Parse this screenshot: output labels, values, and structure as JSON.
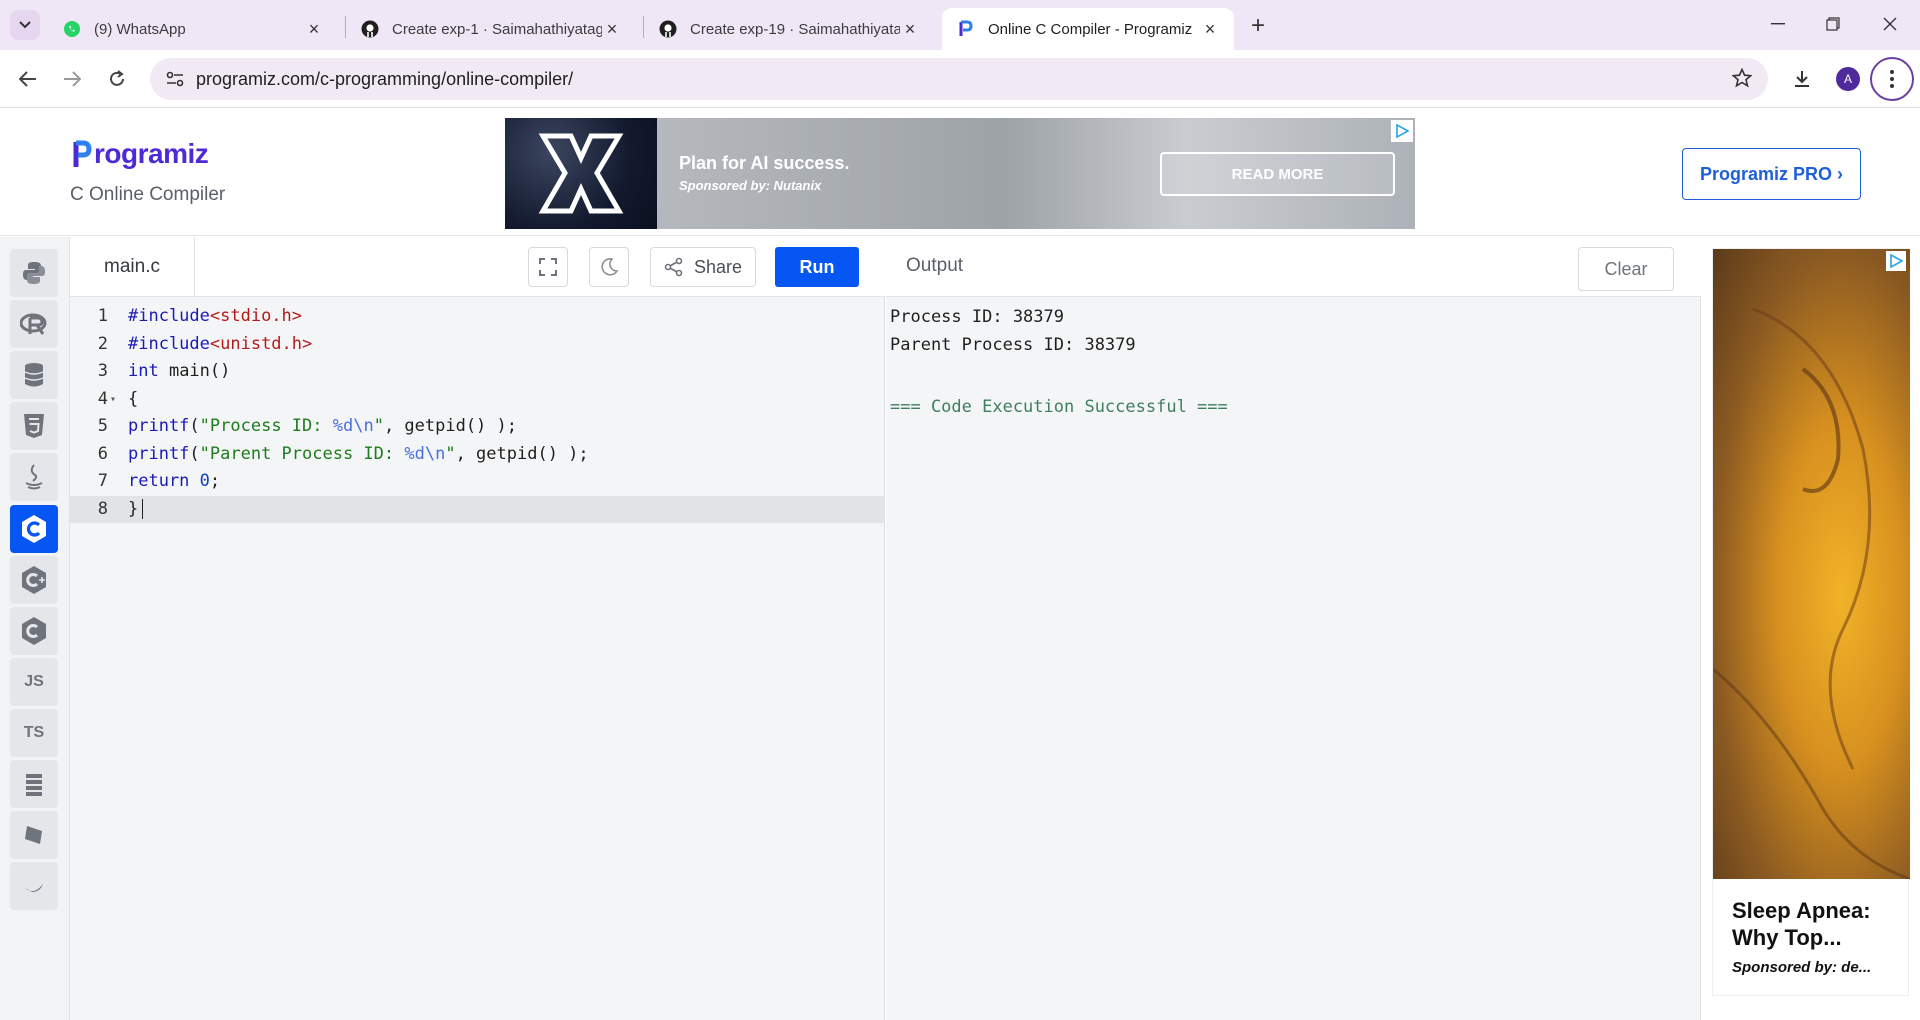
{
  "browser": {
    "tabs": [
      {
        "title": "(9) WhatsApp",
        "icon": "whatsapp-icon",
        "active": false
      },
      {
        "title": "Create exp-1 · Saimahathiyatagi",
        "icon": "github-icon",
        "active": false
      },
      {
        "title": "Create exp-19 · Saimahathiyata",
        "icon": "github-icon",
        "active": false
      },
      {
        "title": "Online C Compiler - Programiz",
        "icon": "programiz-icon",
        "active": true
      }
    ],
    "url": "programiz.com/c-programming/online-compiler/",
    "profile_initial": "A"
  },
  "header": {
    "logo_text": "rogramiz",
    "subtitle": "C Online Compiler",
    "pro_button": "Programiz PRO ›",
    "ad": {
      "title": "Plan for AI success.",
      "sponsor": "Sponsored by: Nutanix",
      "cta": "READ MORE"
    }
  },
  "rail": {
    "items": [
      {
        "name": "python-icon",
        "label": ""
      },
      {
        "name": "r-icon",
        "label": ""
      },
      {
        "name": "sql-icon",
        "label": ""
      },
      {
        "name": "html5-icon",
        "label": ""
      },
      {
        "name": "java-icon",
        "label": ""
      },
      {
        "name": "c-icon",
        "label": "",
        "active": true
      },
      {
        "name": "cpp-icon",
        "label": ""
      },
      {
        "name": "csharp-icon",
        "label": ""
      },
      {
        "name": "js-icon",
        "label": "JS"
      },
      {
        "name": "ts-icon",
        "label": "TS"
      },
      {
        "name": "golang-icon",
        "label": ""
      },
      {
        "name": "php-icon",
        "label": ""
      },
      {
        "name": "swift-icon",
        "label": ""
      }
    ]
  },
  "editor": {
    "file_name": "main.c",
    "share_label": "Share",
    "run_label": "Run",
    "lines": [
      "1",
      "2",
      "3",
      "4",
      "5",
      "6",
      "7",
      "8"
    ],
    "current_line": 8
  },
  "output": {
    "title": "Output",
    "clear_label": "Clear",
    "lines": [
      "Process ID: 38379",
      "Parent Process ID: 38379",
      "=== Code Execution Successful ==="
    ]
  },
  "side_ad": {
    "title": "Sleep Apnea: Why Top...",
    "sponsor": "Sponsored by: de..."
  },
  "colors": {
    "accent": "#0556f3",
    "brand": "#4d2ad8",
    "chrome": "#f0e7f6"
  }
}
